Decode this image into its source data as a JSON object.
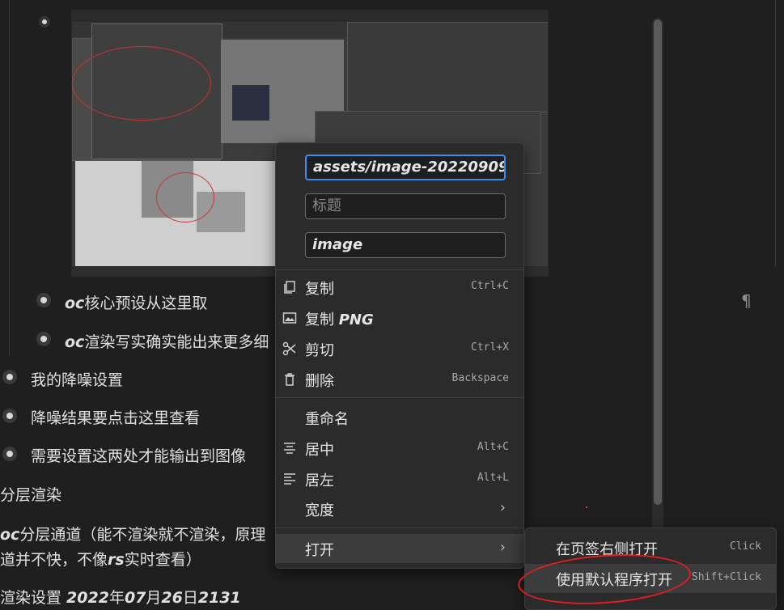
{
  "editor": {
    "lines": [
      {
        "id": "l1",
        "prefix": "oc",
        "text": "核心预设从这里取"
      },
      {
        "id": "l2",
        "prefix": "oc",
        "text": "渲染写实确实能出来更多细"
      },
      {
        "id": "l3",
        "text": "我的降噪设置"
      },
      {
        "id": "l4",
        "text": "降噪结果要点击这里查看"
      },
      {
        "id": "l5",
        "text": "需要设置这两处才能输出到图像"
      },
      {
        "id": "l6",
        "text": "分层渲染"
      },
      {
        "id": "l7a_prefix",
        "text": "oc"
      },
      {
        "id": "l7a",
        "text": "分层通道（能不渲染就不渲染，原理"
      },
      {
        "id": "l7b_a",
        "text": "道并不快，不像"
      },
      {
        "id": "l7b_b",
        "text": "rs"
      },
      {
        "id": "l7b_c",
        "text": "实时查看）"
      },
      {
        "id": "l8a",
        "text": "渲染设置 "
      },
      {
        "id": "l8b",
        "text": "2022"
      },
      {
        "id": "l8c",
        "text": "年"
      },
      {
        "id": "l8d",
        "text": "07"
      },
      {
        "id": "l8e",
        "text": "月"
      },
      {
        "id": "l8f",
        "text": "26"
      },
      {
        "id": "l8g",
        "text": "日"
      },
      {
        "id": "l8h",
        "text": "2131"
      }
    ],
    "para_mark": "¶"
  },
  "menu": {
    "src_value": "assets/image-20220909",
    "title_placeholder": "标题",
    "alt_value": "image",
    "items": {
      "copy": {
        "label": "复制",
        "key": "Ctrl+C"
      },
      "copy_png": {
        "label_a": "复制 ",
        "label_b": "PNG"
      },
      "cut": {
        "label": "剪切",
        "key": "Ctrl+X"
      },
      "delete": {
        "label": "删除",
        "key": "Backspace"
      },
      "rename": {
        "label": "重命名"
      },
      "center": {
        "label": "居中",
        "key": "Alt+C"
      },
      "left": {
        "label": "居左",
        "key": "Alt+L"
      },
      "width": {
        "label": "宽度",
        "chev": "›"
      },
      "open": {
        "label": "打开",
        "chev": "›"
      }
    }
  },
  "submenu": {
    "open_right": {
      "label": "在页签右侧打开",
      "key": "Click"
    },
    "open_default": {
      "label": "使用默认程序打开",
      "key": "Shift+Click"
    }
  },
  "colors": {
    "accent": "#3b8ef0",
    "annotation": "#e01f1f"
  }
}
